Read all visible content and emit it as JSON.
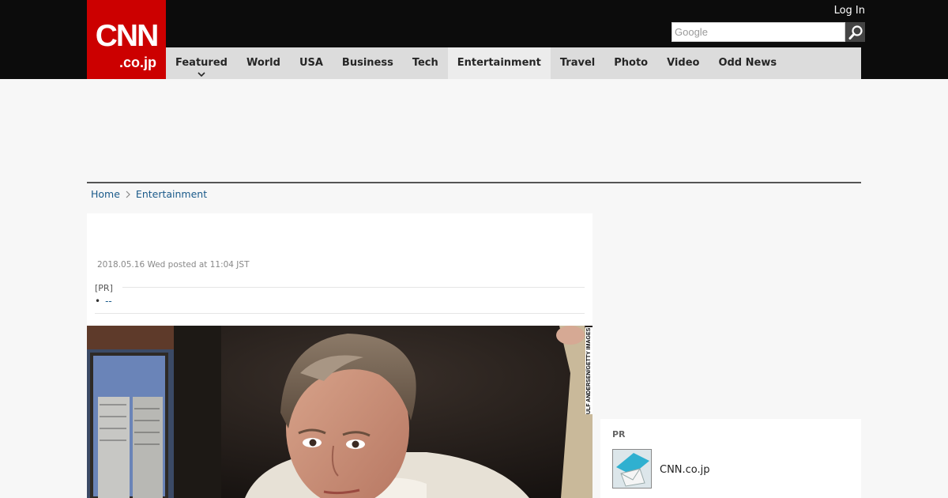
{
  "header": {
    "logo_top": "CNN",
    "logo_bottom": ".co.jp",
    "login_label": "Log In",
    "search_placeholder": "Google"
  },
  "nav": {
    "items": [
      {
        "label": "Featured"
      },
      {
        "label": "World"
      },
      {
        "label": "USA"
      },
      {
        "label": "Business"
      },
      {
        "label": "Tech"
      },
      {
        "label": "Entertainment"
      },
      {
        "label": "Travel"
      },
      {
        "label": "Photo"
      },
      {
        "label": "Video"
      },
      {
        "label": "Odd News"
      }
    ],
    "active": "Entertainment"
  },
  "breadcrumb": {
    "home": "Home",
    "current": "Entertainment"
  },
  "article": {
    "date": "2018.05.16 Wed posted at 11:04 JST",
    "pr_label": "[PR]",
    "pr_link": "--",
    "photo_credit": "ULF ANDERSEN/GETTY IMAGES"
  },
  "rail": {
    "pr_header": "PR",
    "pr_item_title": "CNN.co.jp"
  },
  "colors": {
    "brand_red": "#cc0000",
    "header_bg": "#0c0c0c",
    "nav_bg": "#dcdcdc",
    "link": "#1a5a8a"
  }
}
